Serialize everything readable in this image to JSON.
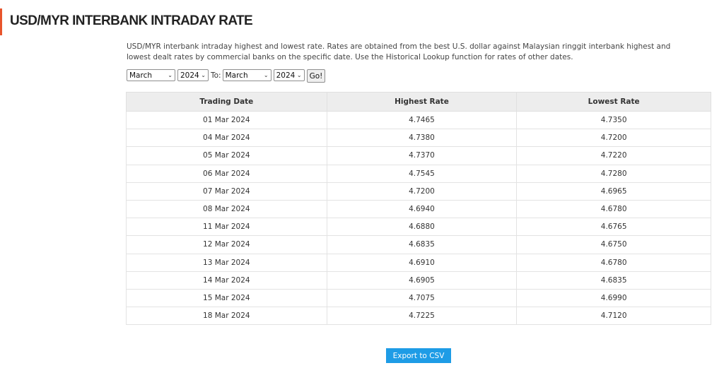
{
  "page": {
    "title": "USD/MYR INTERBANK INTRADAY RATE",
    "description": "USD/MYR interbank intraday highest and lowest rate. Rates are obtained from the best U.S. dollar against Malaysian ringgit interbank highest and lowest dealt rates by commercial banks on the specific date. Use the Historical Lookup function for rates of other dates.",
    "accent_color": "#e8542c"
  },
  "filter": {
    "from_month": "March",
    "from_year": "2024",
    "to_label": "To:",
    "to_month": "March",
    "to_year": "2024",
    "go_label": "Go!"
  },
  "table": {
    "headers": [
      "Trading Date",
      "Highest Rate",
      "Lowest Rate"
    ],
    "rows": [
      [
        "01 Mar 2024",
        "4.7465",
        "4.7350"
      ],
      [
        "04 Mar 2024",
        "4.7380",
        "4.7200"
      ],
      [
        "05 Mar 2024",
        "4.7370",
        "4.7220"
      ],
      [
        "06 Mar 2024",
        "4.7545",
        "4.7280"
      ],
      [
        "07 Mar 2024",
        "4.7200",
        "4.6965"
      ],
      [
        "08 Mar 2024",
        "4.6940",
        "4.6780"
      ],
      [
        "11 Mar 2024",
        "4.6880",
        "4.6765"
      ],
      [
        "12 Mar 2024",
        "4.6835",
        "4.6750"
      ],
      [
        "13 Mar 2024",
        "4.6910",
        "4.6780"
      ],
      [
        "14 Mar 2024",
        "4.6905",
        "4.6835"
      ],
      [
        "15 Mar 2024",
        "4.7075",
        "4.6990"
      ],
      [
        "18 Mar 2024",
        "4.7225",
        "4.7120"
      ]
    ]
  },
  "export": {
    "label": "Export to CSV",
    "color": "#1e9ce6"
  }
}
